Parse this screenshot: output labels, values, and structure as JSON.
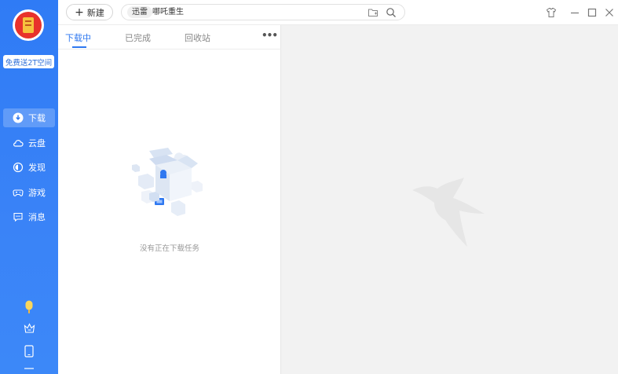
{
  "sidebar": {
    "promo_label": "免费送2T空间",
    "items": [
      {
        "label": "下载",
        "icon": "download-icon",
        "active": true
      },
      {
        "label": "云盘",
        "icon": "cloud-icon",
        "active": false
      },
      {
        "label": "发现",
        "icon": "discover-icon",
        "active": false
      },
      {
        "label": "游戏",
        "icon": "gamepad-icon",
        "active": false
      },
      {
        "label": "消息",
        "icon": "message-icon",
        "active": false
      }
    ],
    "bottom_icons": [
      "popsicle-icon",
      "crown-icon",
      "tablet-icon",
      "menu-icon"
    ]
  },
  "toolbar": {
    "new_label": "新建",
    "search_chips": [
      "迅雷",
      "哪吒重生"
    ],
    "icons": [
      "add-folder-icon",
      "search-icon"
    ]
  },
  "window_controls": [
    "skin-icon",
    "minimize-icon",
    "maximize-icon",
    "close-icon"
  ],
  "tabs": [
    "下载中",
    "已完成",
    "回收站"
  ],
  "more_label": "•••",
  "empty_state": {
    "text": "没有正在下载任务"
  },
  "colors": {
    "accent": "#2f78f0",
    "sidebar": "#3380f6",
    "background": "#f2f2f2"
  }
}
